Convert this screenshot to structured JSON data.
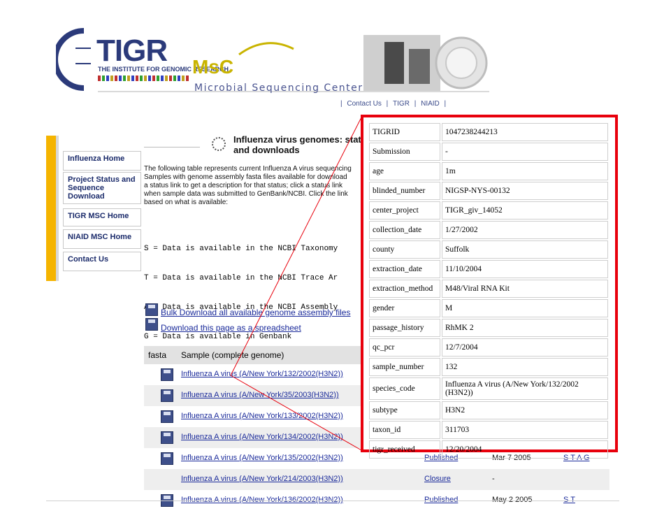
{
  "header": {
    "logo_text": "TIGR",
    "institute": "THE INSTITUTE FOR GENOMIC RESEARCH",
    "msc_logo": "MsC",
    "center_name": "Microbial Sequencing Center",
    "top_links": [
      "Contact Us",
      "TIGR",
      "NIAID"
    ]
  },
  "nav": {
    "items": [
      {
        "label": "Influenza Home"
      },
      {
        "label": "Project Status and Sequence Download"
      },
      {
        "label": "TIGR MSC Home"
      },
      {
        "label": "NIAID MSC Home"
      },
      {
        "label": "Contact Us"
      }
    ]
  },
  "main": {
    "title": "Influenza virus genomes: status and downloads",
    "intro_lines": [
      "The following table represents current Influenza A virus sequencing",
      "Samples with genome assembly fasta files available for download",
      "a status link to get a description for that status; click a status link",
      "when sample data was submitted to GenBank/NCBI. Click the link",
      "based on what is available:"
    ],
    "codes": [
      "S = Data is available in the NCBI Taxonomy",
      "T = Data is available in the NCBI Trace Ar",
      "A = Data is available in the NCBI Assembly",
      "G = Data is available in Genbank"
    ],
    "download_bulk": "Bulk Download all available genome assembly files",
    "download_sheet": "Download this page as a spreadsheet"
  },
  "grid": {
    "col_fasta": "fasta",
    "col_sample": "Sample (complete genome)",
    "rows": [
      {
        "sample": "Influenza A virus (A/New York/132/2002(H3N2))",
        "status": "",
        "date": "",
        "links": "",
        "fasta": true
      },
      {
        "sample": "Influenza A virus (A/New York/35/2003(H3N2))",
        "status": "",
        "date": "",
        "links": "",
        "fasta": true
      },
      {
        "sample": "Influenza A virus (A/New York/133/2002(H3N2))",
        "status": "",
        "date": "",
        "links": "",
        "fasta": true
      },
      {
        "sample": "Influenza A virus (A/New York/134/2002(H3N2))",
        "status": "",
        "date": "",
        "links": "",
        "fasta": true
      },
      {
        "sample": "Influenza A virus (A/New York/135/2002(H3N2))",
        "status": "Published",
        "date": "Mar 7 2005",
        "links": "S T A G",
        "fasta": true
      },
      {
        "sample": "Influenza A virus (A/New York/214/2003(H3N2))",
        "status": "Closure",
        "date": "-",
        "links": "",
        "fasta": false
      },
      {
        "sample": "Influenza A virus (A/New York/136/2002(H3N2))",
        "status": "Published",
        "date": "May 2 2005",
        "links": "S T",
        "fasta": true
      }
    ]
  },
  "popup": {
    "rows": [
      [
        "TIGRID",
        "1047238244213"
      ],
      [
        "Submission",
        "-"
      ],
      [
        "age",
        "1m"
      ],
      [
        "blinded_number",
        "NIGSP-NYS-00132"
      ],
      [
        "center_project",
        "TIGR_giv_14052"
      ],
      [
        "collection_date",
        "1/27/2002"
      ],
      [
        "county",
        "Suffolk"
      ],
      [
        "extraction_date",
        "11/10/2004"
      ],
      [
        "extraction_method",
        "M48/Viral RNA Kit"
      ],
      [
        "gender",
        "M"
      ],
      [
        "passage_history",
        "RhMK 2"
      ],
      [
        "qc_pcr",
        "12/7/2004"
      ],
      [
        "sample_number",
        "132"
      ],
      [
        "species_code",
        "Influenza A virus (A/New York/132/2002 (H3N2))"
      ],
      [
        "subtype",
        "H3N2"
      ],
      [
        "taxon_id",
        "311703"
      ],
      [
        "tigr_received",
        "12/20/2004"
      ]
    ]
  },
  "colors": {
    "highlight": "#e8000c",
    "nav_accent": "#f5b400",
    "link": "#1a2a9a"
  }
}
